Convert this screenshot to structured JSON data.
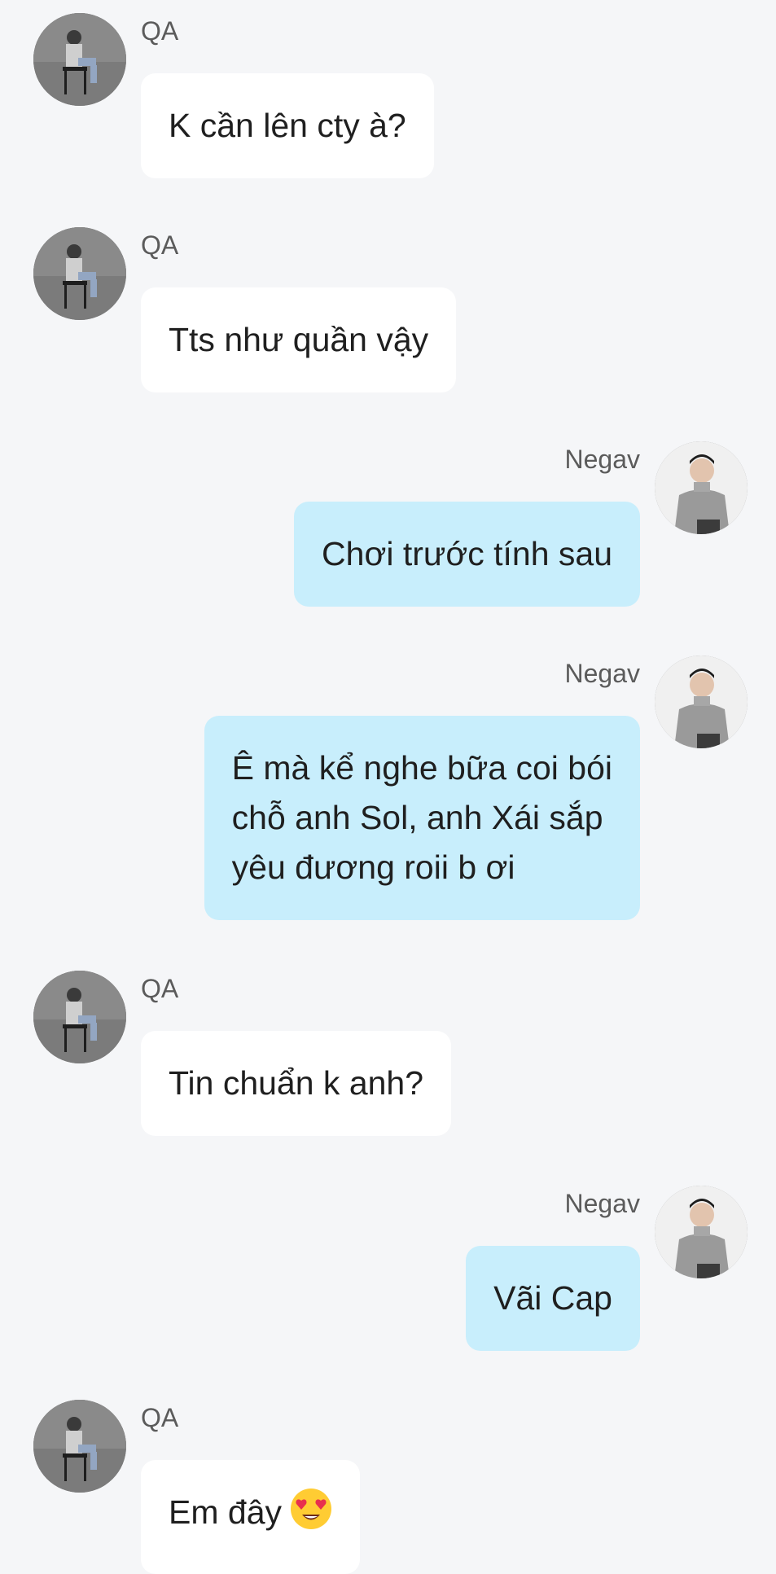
{
  "users": {
    "qa": {
      "name": "QA",
      "avatar_icon": "avatar-qa-icon"
    },
    "negav": {
      "name": "Negav",
      "avatar_icon": "avatar-negav-icon"
    }
  },
  "colors": {
    "background": "#f5f6f8",
    "incoming_bubble": "#ffffff",
    "outgoing_bubble": "#c8eefc",
    "sender_text": "#5b5b5b"
  },
  "messages": [
    {
      "sender": "QA",
      "direction": "incoming",
      "text": "K cần lên cty à?"
    },
    {
      "sender": "QA",
      "direction": "incoming",
      "text": "Tts như quần vậy"
    },
    {
      "sender": "Negav",
      "direction": "outgoing",
      "text": "Chơi trước tính sau"
    },
    {
      "sender": "Negav",
      "direction": "outgoing",
      "text": "Ê mà kể nghe bữa coi bói\nchỗ anh Sol, anh Xái sắp\nyêu đương roii b ơi"
    },
    {
      "sender": "QA",
      "direction": "incoming",
      "text": "Tin chuẩn k anh?"
    },
    {
      "sender": "Negav",
      "direction": "outgoing",
      "text": "Vãi Cap"
    },
    {
      "sender": "QA",
      "direction": "incoming",
      "text": "Em đây",
      "emoji": "heart-eyes-emoji"
    }
  ]
}
